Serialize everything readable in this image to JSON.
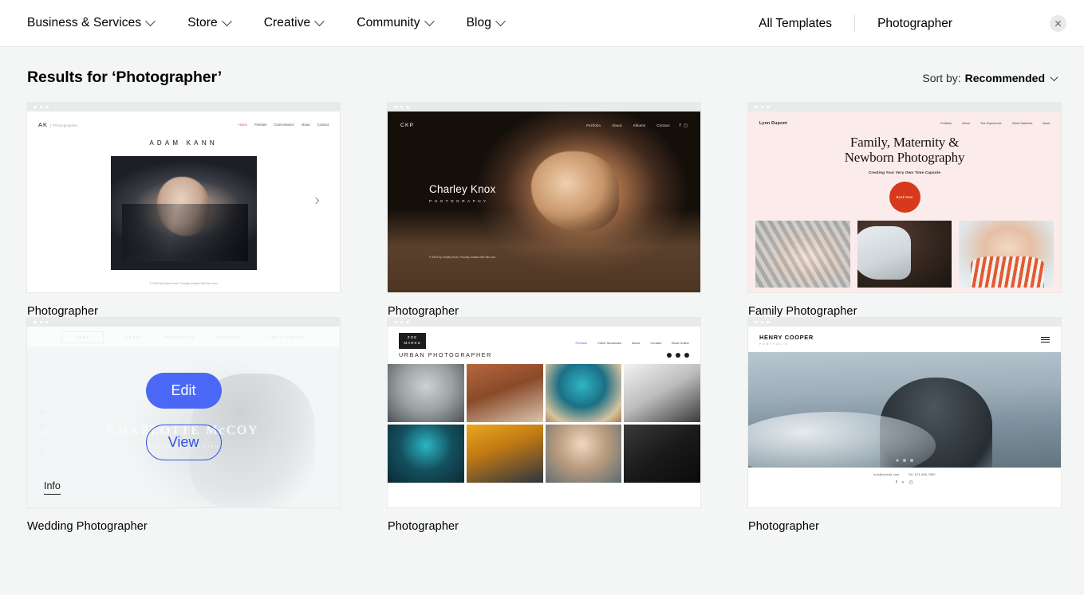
{
  "topbar": {
    "menu": [
      {
        "label": "Business & Services",
        "icon": "chevron-down-icon"
      },
      {
        "label": "Store",
        "icon": "chevron-down-icon"
      },
      {
        "label": "Creative",
        "icon": "chevron-down-icon"
      },
      {
        "label": "Community",
        "icon": "chevron-down-icon"
      },
      {
        "label": "Blog",
        "icon": "chevron-down-icon"
      }
    ],
    "all_templates": "All Templates",
    "query": "Photographer",
    "close_icon": "close-icon"
  },
  "results": {
    "title": "Results for ‘Photographer’",
    "sort_label": "Sort by:",
    "sort_value": "Recommended",
    "sort_icon": "chevron-down-icon"
  },
  "hover": {
    "edit_label": "Edit",
    "view_label": "View",
    "info_label": "Info",
    "accent_fill": "#4a68f5",
    "accent_outline": "#2f52e0"
  },
  "cards": [
    {
      "label": "Photographer",
      "logo": "AK",
      "logo_sub": "| Photographer",
      "menu": [
        "Home",
        "Portraits",
        "Commissions",
        "About",
        "Contact"
      ],
      "title": "ADAM KANN",
      "footer": "© 2023 by Adam Kann. Proudly created with Wix.com",
      "arrow_icon": "chevron-right-icon"
    },
    {
      "label": "Photographer",
      "logo": "CKP",
      "menu": [
        "Portfolio",
        "About",
        "Albums",
        "Contact"
      ],
      "social": [
        "facebook-icon",
        "instagram-icon"
      ],
      "title": "Charley Knox",
      "subtitle": "PHOTOGRAPHY",
      "footer": "© 2023 by Charley Knox. Proudly created with Wix.com"
    },
    {
      "label": "Family Photographer",
      "logo": "Lynn Dupont",
      "menu": [
        "Portfolio",
        "About",
        "The Experience",
        "Client Galleries",
        "Book"
      ],
      "title_line1": "Family, Maternity &",
      "title_line2": "Newborn Photography",
      "subtitle": "Creating Your Very Own Time Capsule",
      "cta": "Book Now",
      "cta_color": "#d8381b",
      "bg_color": "#fbeceb"
    },
    {
      "label": "Wedding Photographer",
      "menu": [
        "HOME",
        "ABOUT",
        "PORTFOLIO",
        "CONTACT",
        "CLIENT ALBUMS"
      ],
      "title": "CHARLOTTE McCOY",
      "subtitle": "WEDDING PHOTOGRAPHY",
      "hovered": true
    },
    {
      "label": "Photographer",
      "logo_line1": "ZOE",
      "logo_line2": "MARKS",
      "menu": [
        "Portfolio",
        "Client Showcase",
        "About",
        "Contact",
        "Book Online"
      ],
      "heading": "URBAN PHOTOGRAPHER",
      "social": [
        "facebook-icon",
        "twitter-icon",
        "instagram-icon"
      ]
    },
    {
      "label": "Photographer",
      "brand": "HENRY COOPER",
      "brand_sub": "PORTFOLIO",
      "menu_icon": "hamburger-menu-icon",
      "footer_email": "info@mysite.com",
      "footer_phone": "Tel: 123-456-7890",
      "social": [
        "facebook-icon",
        "twitter-icon",
        "instagram-icon"
      ]
    }
  ]
}
